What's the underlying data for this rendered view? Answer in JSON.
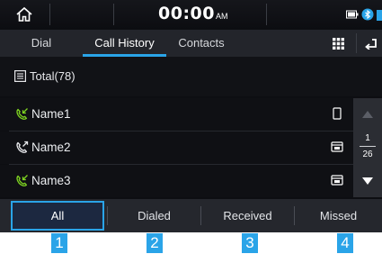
{
  "status": {
    "time": "00:00",
    "ampm": "AM"
  },
  "tabs": {
    "dial": "Dial",
    "call_history": "Call History",
    "contacts": "Contacts"
  },
  "header": {
    "total": "Total(78)"
  },
  "calls": [
    {
      "name": "Name1",
      "call_type": "received",
      "phone_type": "mobile"
    },
    {
      "name": "Name2",
      "call_type": "dialed",
      "phone_type": "home"
    },
    {
      "name": "Name3",
      "call_type": "received",
      "phone_type": "home"
    }
  ],
  "pager": {
    "current": "1",
    "total": "26"
  },
  "filters": {
    "all": "All",
    "dialed": "Dialed",
    "received": "Received",
    "missed": "Missed",
    "selected": "All"
  },
  "callouts": [
    "1",
    "2",
    "3",
    "4"
  ],
  "colors": {
    "accent": "#2aa4e8",
    "received_icon": "#7ed321",
    "background": "#0d0e12"
  }
}
